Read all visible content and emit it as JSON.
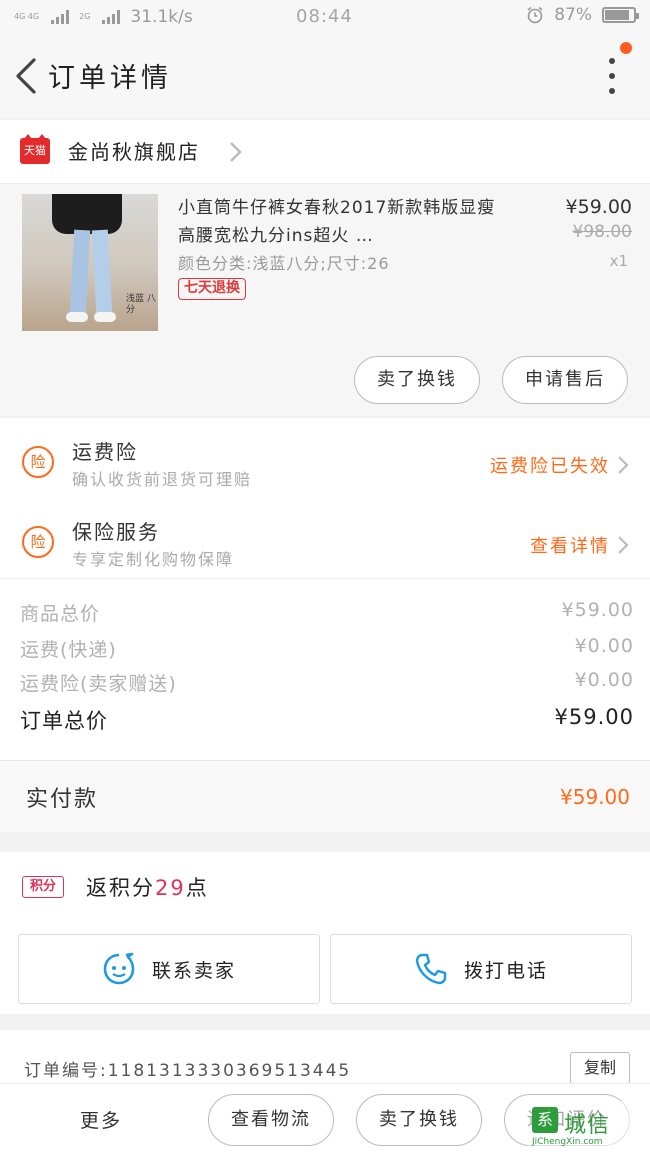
{
  "status_bar": {
    "net_tag_1": "4G 4G",
    "net_tag_2": "2G",
    "speed": "31.1k/s",
    "time": "08:44",
    "battery": "87%"
  },
  "header": {
    "title": "订单详情"
  },
  "store": {
    "badge": "天猫",
    "name": "金尚秋旗舰店"
  },
  "product": {
    "title": "小直筒牛仔裤女春秋2017新款韩版显瘦高腰宽松九分ins超火 …",
    "spec": "颜色分类:浅蓝八分;尺寸:26",
    "return_badge": "七天退换",
    "price": "¥59.00",
    "old_price": "¥98.00",
    "qty": "x1",
    "image_tag": "浅蓝 八分",
    "buttons": {
      "exchange": "卖了换钱",
      "after_sale": "申请售后"
    }
  },
  "insurance": [
    {
      "icon": "险",
      "title": "运费险",
      "subtitle": "确认收货前退货可理赔",
      "status": "运费险已失效"
    },
    {
      "icon": "险",
      "title": "保险服务",
      "subtitle": "专享定制化购物保障",
      "status": "查看详情"
    }
  ],
  "summary": {
    "rows": [
      {
        "label": "商品总价",
        "value": "¥59.00"
      },
      {
        "label": "运费(快递)",
        "value": "¥0.00"
      },
      {
        "label": "运费险(卖家赠送)",
        "value": "¥0.00"
      }
    ],
    "total_label": "订单总价",
    "total_value": "¥59.00"
  },
  "payment": {
    "label": "实付款",
    "value": "¥59.00"
  },
  "points": {
    "badge": "积分",
    "prefix": "返积分",
    "number": "29",
    "suffix": "点"
  },
  "contact": {
    "seller": "联系卖家",
    "call": "拨打电话"
  },
  "order": {
    "label": "订单编号:",
    "number": "1181313330369513445",
    "copy": "复制"
  },
  "bottom_bar": {
    "more": "更多",
    "logistics": "查看物流",
    "exchange": "卖了换钱",
    "review": "追加评价"
  },
  "watermark": {
    "box": "系",
    "text": "城信",
    "url": "JiChengXin.com"
  },
  "colors": {
    "accent": "#ff6a1a",
    "points": "#e0325a",
    "tmall": "#e32b2b"
  }
}
